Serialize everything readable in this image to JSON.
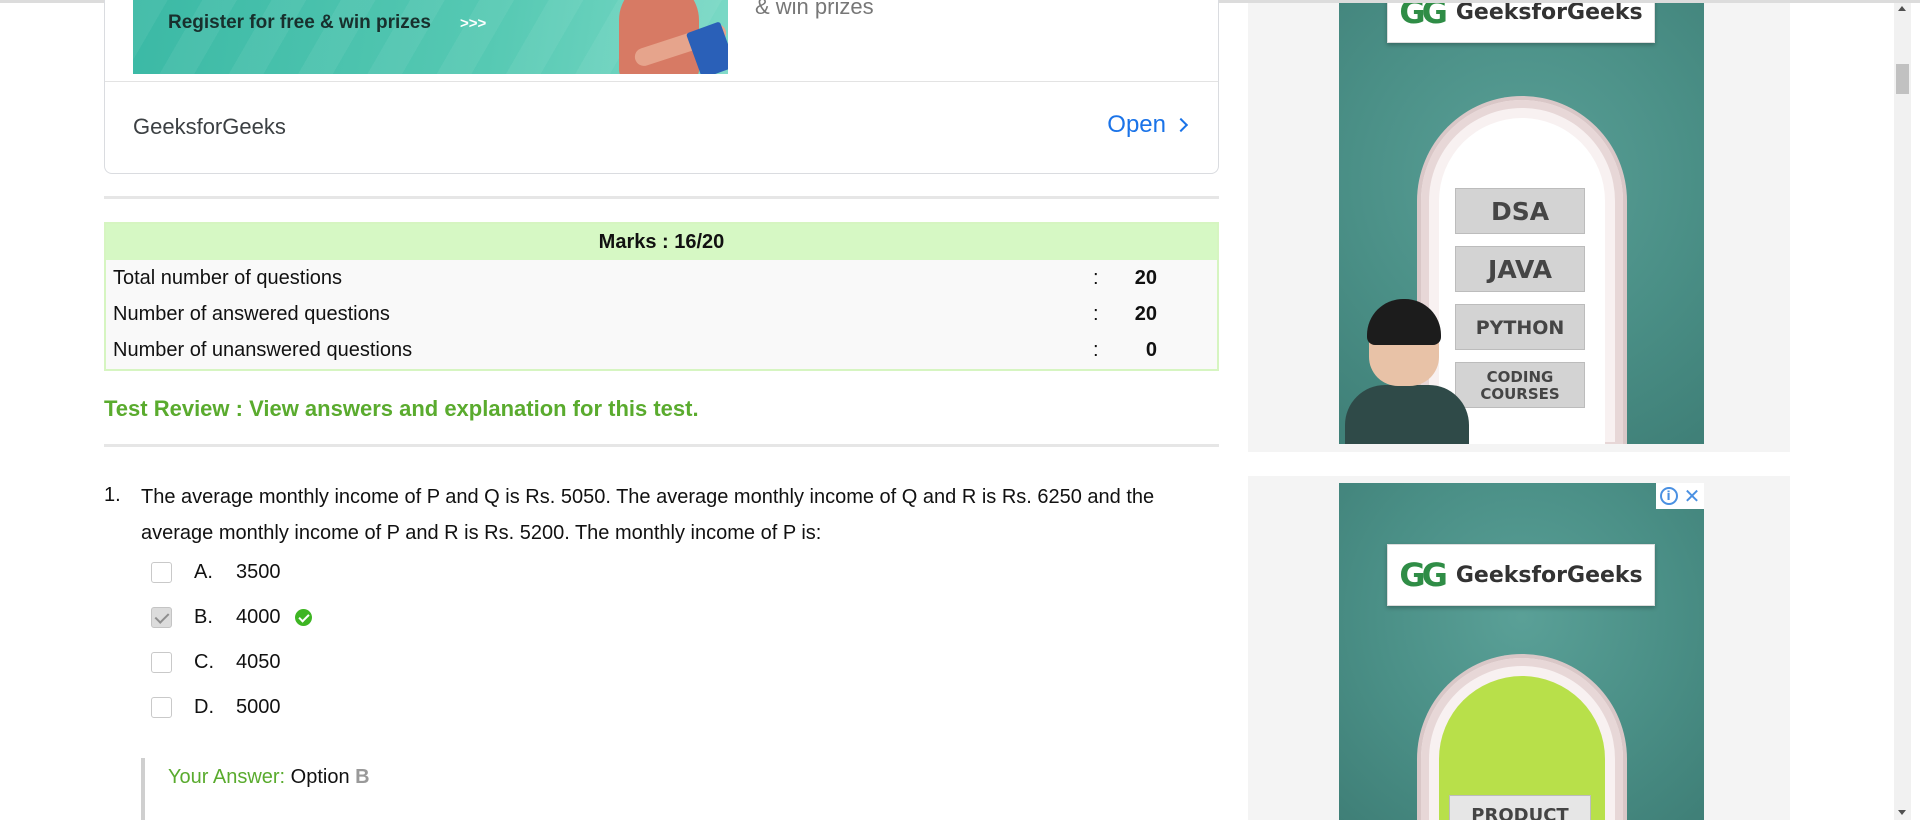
{
  "ad": {
    "banner_text": "Register for free & win prizes",
    "banner_arrows": ">>>",
    "side_text": "& win prizes",
    "brand": "GeeksforGeeks",
    "open_label": "Open"
  },
  "marks": {
    "heading": "Marks : 16/20",
    "rows": [
      {
        "label": "Total number of questions",
        "colon": ":",
        "value": "20"
      },
      {
        "label": "Number of answered questions",
        "colon": ":",
        "value": "20"
      },
      {
        "label": "Number of unanswered questions",
        "colon": ":",
        "value": "0"
      }
    ]
  },
  "review_link": "Test Review : View answers and explanation for this test.",
  "question": {
    "number": "1.",
    "text": "The average monthly income of P and Q is Rs. 5050. The average monthly income of Q and R is Rs. 6250 and the average monthly income of P and R is Rs. 5200. The monthly income of P is:",
    "options": [
      {
        "letter": "A.",
        "value": "3500",
        "checked": false,
        "correct": false
      },
      {
        "letter": "B.",
        "value": "4000",
        "checked": true,
        "correct": true
      },
      {
        "letter": "C.",
        "value": "4050",
        "checked": false,
        "correct": false
      },
      {
        "letter": "D.",
        "value": "5000",
        "checked": false,
        "correct": false
      }
    ],
    "your_answer_label": "Your Answer:",
    "your_answer_prefix": "Option",
    "your_answer_letter": "B"
  },
  "side_ads": {
    "logo_mark": "GG",
    "logo_name": "GeeksforGeeks",
    "signs": [
      "DSA",
      "JAVA",
      "PYTHON",
      "CODING",
      "COURSES"
    ],
    "product_sign": "PRODUCT",
    "info_icon": "i",
    "close_icon": "✕"
  },
  "colors": {
    "accent_green": "#5aab2e",
    "marks_header_bg": "#d6f8c4",
    "open_blue": "#1a73e8",
    "correct_green": "#3eb523"
  }
}
